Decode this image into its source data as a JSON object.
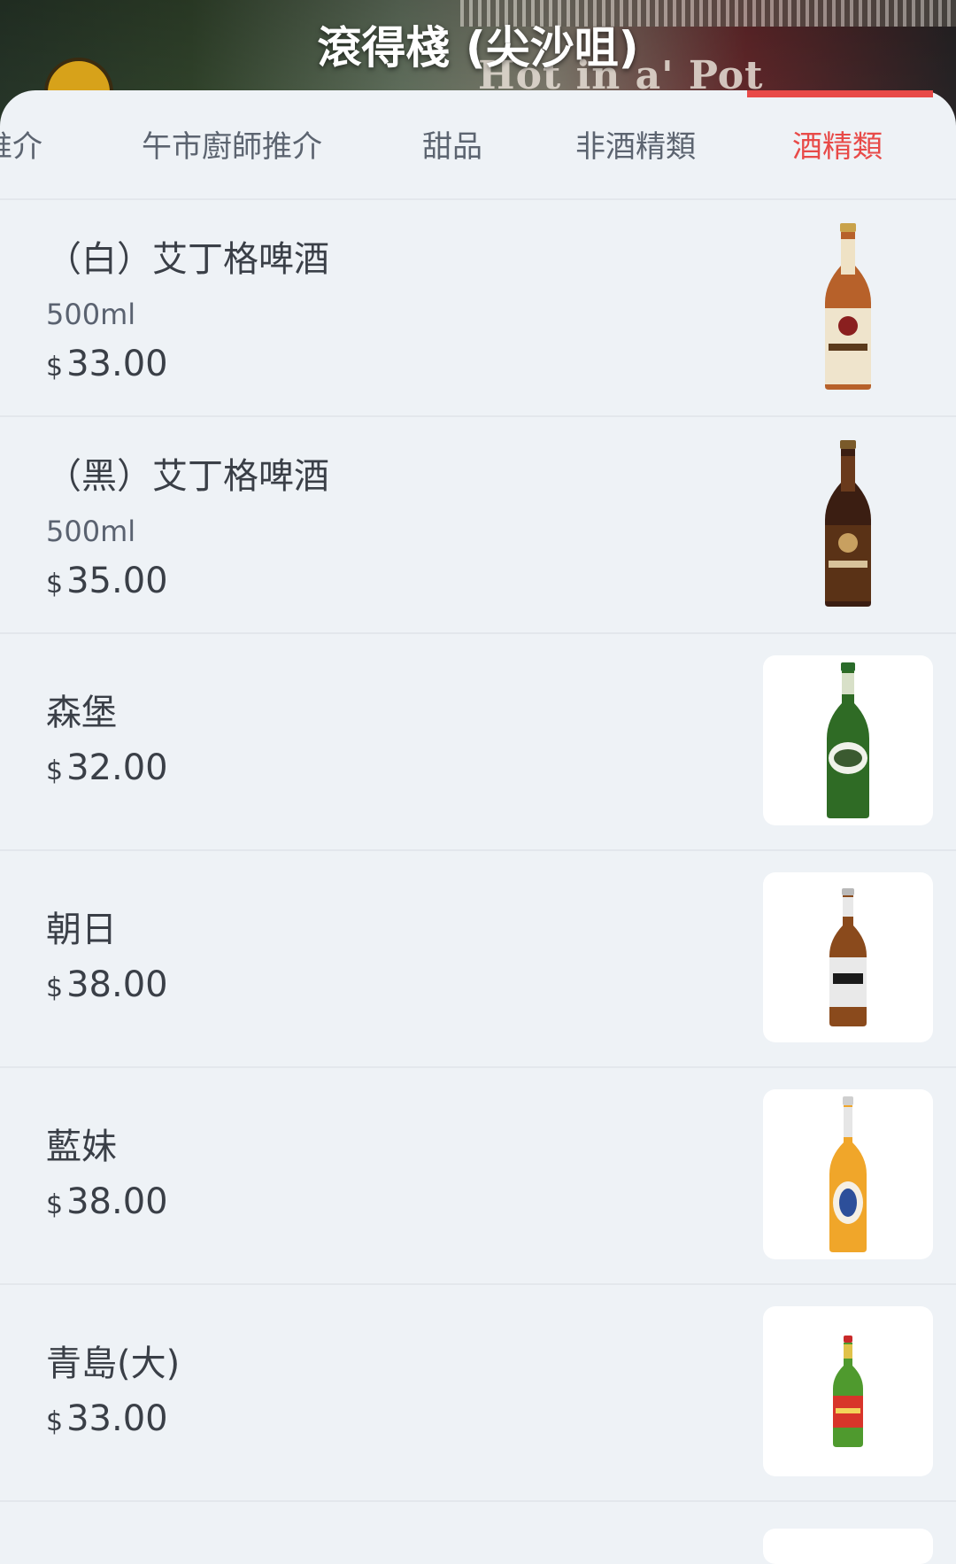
{
  "header": {
    "title": "滾得棧 (尖沙咀)",
    "banner_text": "Hot in a' Pot"
  },
  "tabs": [
    {
      "label": "推介"
    },
    {
      "label": "午市廚師推介"
    },
    {
      "label": "甜品"
    },
    {
      "label": "非酒精類"
    },
    {
      "label": "酒精類",
      "active": true
    }
  ],
  "currency": "$",
  "items": [
    {
      "name": "（白）艾丁格啤酒",
      "size": "500ml",
      "price": "33.00",
      "image": "erdinger-white-bottle"
    },
    {
      "name": "（黑）艾丁格啤酒",
      "size": "500ml",
      "price": "35.00",
      "image": "erdinger-dark-bottle"
    },
    {
      "name": "森堡",
      "price": "32.00",
      "image": "sonderberg-bottle"
    },
    {
      "name": "朝日",
      "price": "38.00",
      "image": "asahi-bottle"
    },
    {
      "name": "藍妹",
      "price": "38.00",
      "image": "blue-girl-bottle"
    },
    {
      "name": "青島(大)",
      "price": "33.00",
      "image": "tsingtao-bottle"
    }
  ],
  "colors": {
    "accent": "#e84a48",
    "background": "#eef2f6",
    "text": "#3a3f47"
  }
}
